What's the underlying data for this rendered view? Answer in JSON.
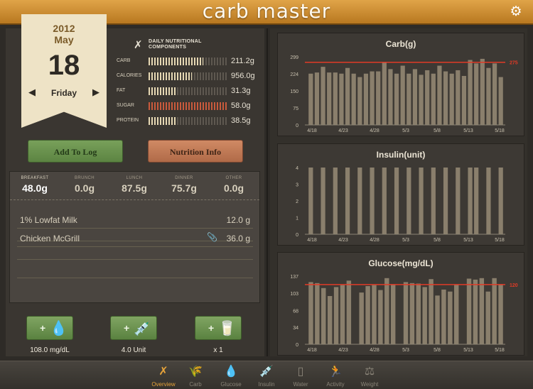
{
  "app": {
    "title": "carb master"
  },
  "date": {
    "year": "2012",
    "month": "May",
    "day": "18",
    "weekday": "Friday"
  },
  "nutrition": {
    "title_line1": "DAILY NUTRITIONAL",
    "title_line2": "COMPONENTS",
    "rows": [
      {
        "label": "CARB",
        "value": "211.2g",
        "level": 0.7
      },
      {
        "label": "CALORIES",
        "value": "956.0g",
        "level": 0.55
      },
      {
        "label": "FAT",
        "value": "31.3g",
        "level": 0.35
      },
      {
        "label": "SUGAR",
        "value": "58.0g",
        "level": 1.0
      },
      {
        "label": "PROTEIN",
        "value": "38.5g",
        "level": 0.35
      }
    ]
  },
  "buttons": {
    "add_to_log": "Add To Log",
    "nutrition_info": "Nutrition Info"
  },
  "meals": [
    {
      "label": "BREAKFAST",
      "value": "48.0g",
      "active": true
    },
    {
      "label": "BRUNCH",
      "value": "0.0g",
      "active": false
    },
    {
      "label": "LUNCH",
      "value": "87.5g",
      "active": false
    },
    {
      "label": "DINNER",
      "value": "75.7g",
      "active": false
    },
    {
      "label": "OTHER",
      "value": "0.0g",
      "active": false
    }
  ],
  "foods": [
    {
      "name": "1% Lowfat Milk",
      "amount": "12.0 g",
      "attachment": false
    },
    {
      "name": "Chicken McGrill",
      "amount": "36.0 g",
      "attachment": true
    }
  ],
  "quick_log": [
    {
      "icon": "glucose-drop-icon",
      "glyph": "💧",
      "label": "108.0 mg/dL"
    },
    {
      "icon": "insulin-syringe-icon",
      "glyph": "💉",
      "label": "4.0 Unit"
    },
    {
      "icon": "water-cup-icon",
      "glyph": "🥛",
      "label": "x 1"
    }
  ],
  "colors": {
    "accent": "#e8a43a",
    "bar": "#8a7f6c",
    "target_line": "#e03a26"
  },
  "chart_data": [
    {
      "type": "bar",
      "title": "Carb(g)",
      "x_ticks": [
        "4/18",
        "4/23",
        "4/28",
        "5/3",
        "5/8",
        "5/13",
        "5/18"
      ],
      "y_ticks": [
        "0",
        "75",
        "150",
        "224",
        "299"
      ],
      "ylim": [
        0,
        299
      ],
      "target": {
        "value": 275,
        "label": "275"
      },
      "values": [
        225,
        230,
        255,
        230,
        230,
        225,
        250,
        225,
        210,
        225,
        235,
        235,
        275,
        245,
        225,
        260,
        225,
        245,
        220,
        240,
        225,
        260,
        235,
        225,
        240,
        215,
        285,
        270,
        290,
        250,
        270,
        210
      ]
    },
    {
      "type": "bar",
      "title": "Insulin(unit)",
      "x_ticks": [
        "4/18",
        "4/23",
        "4/28",
        "5/3",
        "5/8",
        "5/13",
        "5/18"
      ],
      "y_ticks": [
        "0",
        "1",
        "2",
        "3",
        "4"
      ],
      "ylim": [
        0,
        4
      ],
      "values": [
        4,
        0,
        4,
        0,
        4,
        0,
        4,
        0,
        4,
        0,
        4,
        0,
        4,
        0,
        4,
        0,
        4,
        0,
        4,
        0,
        4,
        0,
        4,
        0,
        4,
        0,
        4,
        4,
        0,
        4,
        0,
        4
      ]
    },
    {
      "type": "bar",
      "title": "Glucose(mg/dL)",
      "x_ticks": [
        "4/18",
        "4/23",
        "4/28",
        "5/3",
        "5/8",
        "5/13",
        "5/18"
      ],
      "y_ticks": [
        "0",
        "34",
        "68",
        "103",
        "137"
      ],
      "ylim": [
        0,
        137
      ],
      "target": {
        "value": 120,
        "label": "120"
      },
      "values": [
        125,
        123,
        113,
        97,
        115,
        119,
        128,
        0,
        104,
        117,
        119,
        109,
        133,
        121,
        0,
        125,
        123,
        122,
        115,
        131,
        98,
        110,
        106,
        120,
        0,
        132,
        130,
        133,
        106,
        133,
        121
      ]
    }
  ],
  "tabs": [
    {
      "icon": "overview-icon",
      "glyph": "✗",
      "label": "Overview",
      "active": true
    },
    {
      "icon": "carb-icon",
      "glyph": "🌾",
      "label": "Carb",
      "active": false
    },
    {
      "icon": "glucose-icon",
      "glyph": "💧",
      "label": "Glucose",
      "active": false
    },
    {
      "icon": "insulin-icon",
      "glyph": "💉",
      "label": "Insulin",
      "active": false
    },
    {
      "icon": "water-icon",
      "glyph": "▯",
      "label": "Water",
      "active": false
    },
    {
      "icon": "activity-icon",
      "glyph": "🏃",
      "label": "Activity",
      "active": false
    },
    {
      "icon": "weight-icon",
      "glyph": "⚖",
      "label": "Weight",
      "active": false
    }
  ]
}
